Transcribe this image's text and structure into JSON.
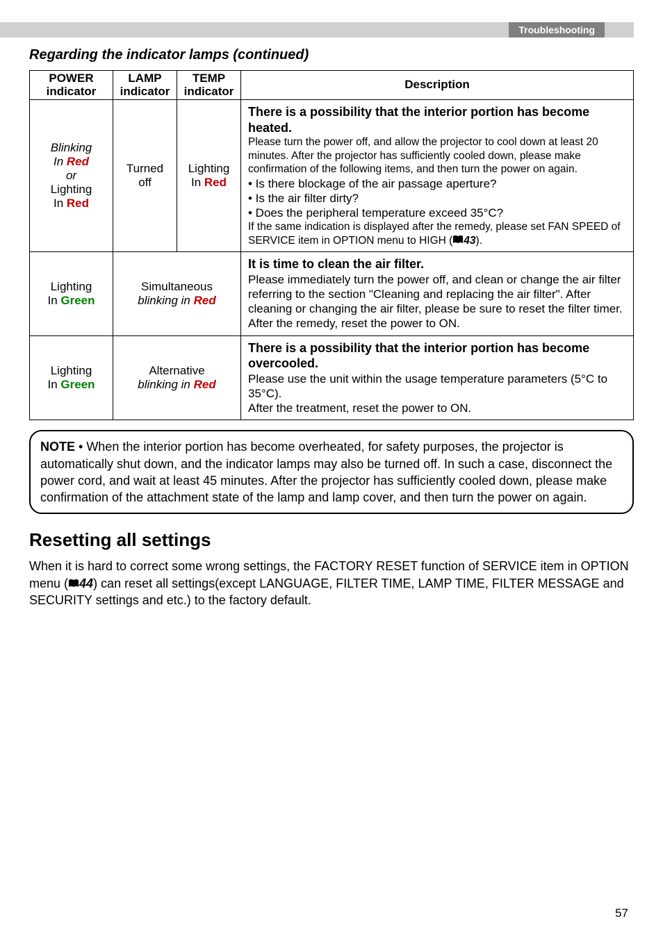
{
  "tab": "Troubleshooting",
  "section_title": "Regarding the indicator lamps (continued)",
  "headers": {
    "power": "POWER indicator",
    "lamp": "LAMP indicator",
    "temp": "TEMP indicator",
    "desc": "Description"
  },
  "row1": {
    "power_l1": "Blinking",
    "power_l2_pre": "In ",
    "power_l2_red": "Red",
    "power_l3": "or",
    "power_l4": "Lighting",
    "power_l5_pre": "In ",
    "power_l5_red": "Red",
    "lamp_l1": "Turned",
    "lamp_l2": "off",
    "temp_l1": "Lighting",
    "temp_l2_pre": "In ",
    "temp_l2_red": "Red",
    "desc_h": "There is a possibility that the interior portion has become heated.",
    "desc_p1": "Please turn the power off, and allow the projector to cool down at least 20 minutes. After the projector has sufficiently cooled down, please make confirmation of the following items, and then turn the power on again.",
    "desc_b1": "• Is there blockage of the air passage aperture?",
    "desc_b2": "• Is the air filter dirty?",
    "desc_b3": "• Does the peripheral temperature exceed 35°C?",
    "desc_p2a": "If the same indication is displayed after the remedy, please set FAN SPEED of SERVICE item in OPTION menu to HIGH (",
    "desc_p2b": "43",
    "desc_p2c": ")."
  },
  "row2": {
    "power_l1": "Lighting",
    "power_l2_pre": "In ",
    "power_l2_green": "Green",
    "combo_l1": "Simultaneous",
    "combo_l2a": "blinking in ",
    "combo_l2b": "Red",
    "desc_h": "It is time to clean the air filter.",
    "desc_p": "Please immediately turn the power off, and clean or change the air filter referring to the section \"Cleaning and replacing the air filter\". After cleaning or changing the air filter, please be sure to reset the filter timer. After the remedy, reset the power to ON."
  },
  "row3": {
    "power_l1": "Lighting",
    "power_l2_pre": "In ",
    "power_l2_green": "Green",
    "combo_l1": "Alternative",
    "combo_l2a": "blinking in ",
    "combo_l2b": "Red",
    "desc_h": "There is a possibility that the interior portion has become overcooled.",
    "desc_p1": "Please use the unit within the usage temperature parameters (5°C to 35°C).",
    "desc_p2": "After the treatment, reset the power to ON."
  },
  "note": {
    "label": "NOTE",
    "text": "  • When the interior portion has become overheated, for safety purposes, the projector is automatically shut down, and the indicator lamps may also be turned off. In such a case, disconnect the power cord, and wait at least 45 minutes. After the projector has sufficiently cooled down, please make confirmation of the attachment state of the lamp and lamp cover, and then turn the power on again."
  },
  "reset": {
    "heading": "Resetting all settings",
    "p_a": "When it is hard to correct some wrong settings, the FACTORY RESET function of SERVICE item in OPTION menu (",
    "p_b": "44",
    "p_c": ") can reset all settings(except LANGUAGE, FILTER TIME, LAMP TIME, FILTER MESSAGE and SECURITY settings and etc.) to the factory default."
  },
  "pagenum": "57"
}
